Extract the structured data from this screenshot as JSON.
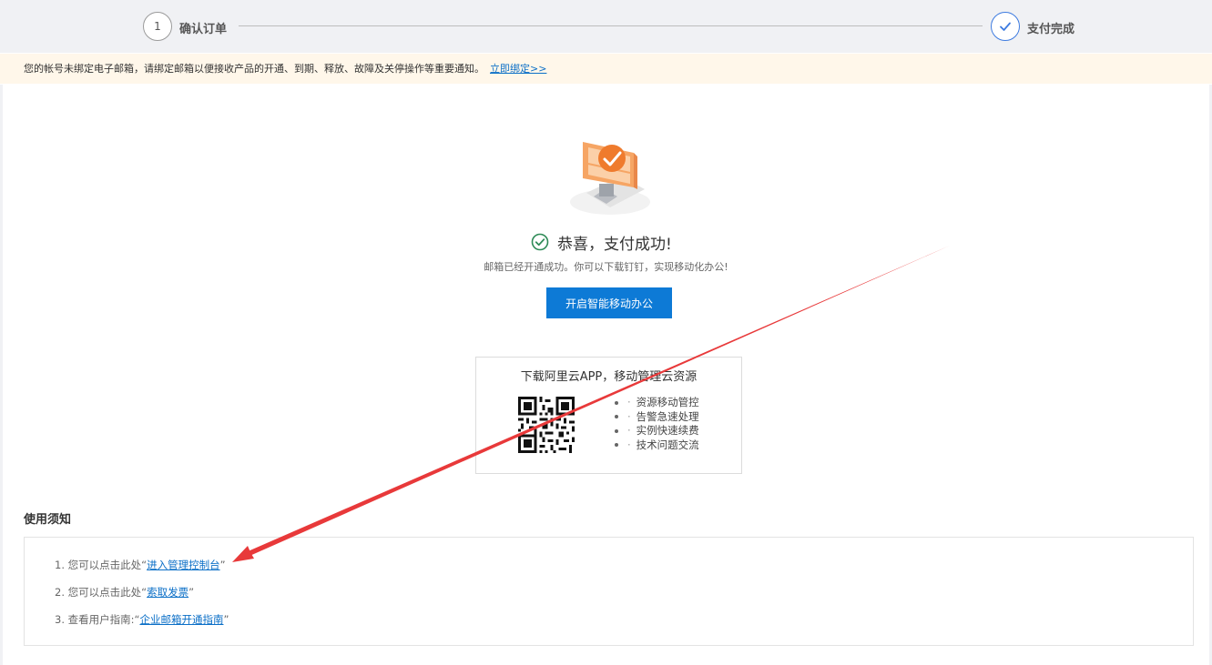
{
  "steps": [
    {
      "number": "1",
      "label": "确认订单"
    },
    {
      "label": "支付完成"
    }
  ],
  "notice": {
    "text": "您的帐号未绑定电子邮箱，请绑定邮箱以便接收产品的开通、到期、释放、故障及关停操作等重要通知。",
    "link": "立即绑定>>"
  },
  "success": {
    "title": "恭喜，支付成功!",
    "subtitle": "邮箱已经开通成功。你可以下载钉钉，实现移动化办公!",
    "button": "开启智能移动办公",
    "colors": {
      "check": "#2e8b57",
      "button": "#0d7ad6",
      "illustration": "#f08a3c"
    }
  },
  "app": {
    "title": "下载阿里云APP，移动管理云资源",
    "features": [
      "资源移动管控",
      "告警急速处理",
      "实例快速续费",
      "技术问题交流"
    ]
  },
  "notes": {
    "title": "使用须知",
    "items": [
      {
        "prefix": "1. 您可以点击此处“",
        "link": "进入管理控制台",
        "suffix": "”"
      },
      {
        "prefix": "2. 您可以点击此处“",
        "link": "索取发票",
        "suffix": "”"
      },
      {
        "prefix": "3. 查看用户指南:“",
        "link": "企业邮箱开通指南",
        "suffix": "”"
      }
    ]
  },
  "annotation": {
    "arrow_color": "#e8393a"
  }
}
